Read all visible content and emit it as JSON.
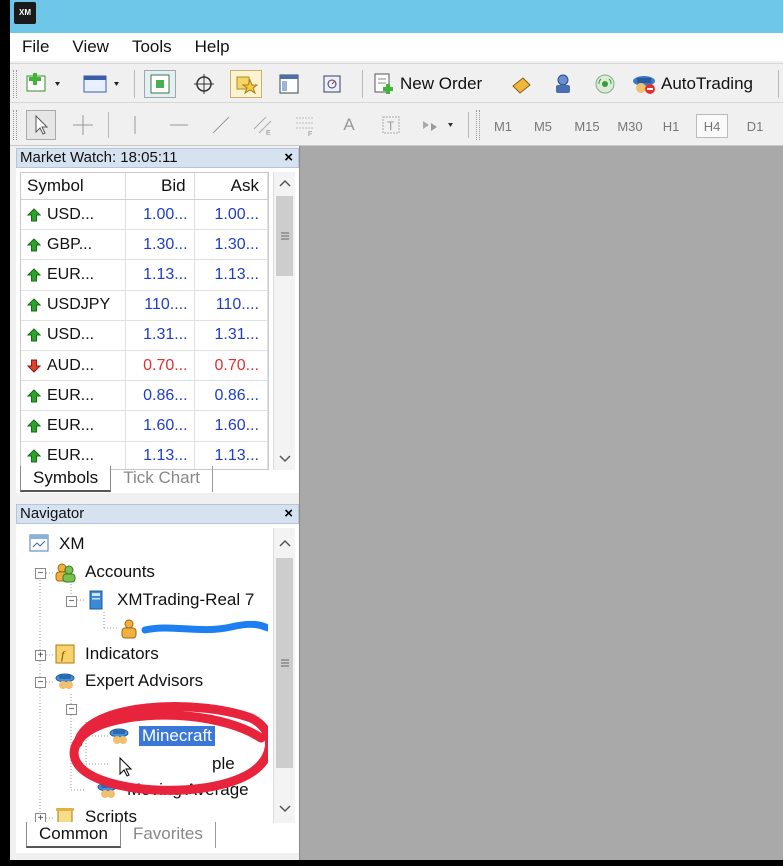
{
  "app": {
    "logo_text": "XM"
  },
  "menu": [
    "File",
    "View",
    "Tools",
    "Help"
  ],
  "toolbar": {
    "new_order": "New Order",
    "autotrading": "AutoTrading",
    "text_tool": "A"
  },
  "timeframes": [
    "M1",
    "M5",
    "M15",
    "M30",
    "H1",
    "H4",
    "D1"
  ],
  "active_timeframe": "H4",
  "market_watch": {
    "title": "Market Watch: 18:05:11",
    "close": "×",
    "columns": [
      "Symbol",
      "Bid",
      "Ask"
    ],
    "rows": [
      {
        "symbol": "USD...",
        "bid": "1.00...",
        "ask": "1.00...",
        "dir": "up"
      },
      {
        "symbol": "GBP...",
        "bid": "1.30...",
        "ask": "1.30...",
        "dir": "up"
      },
      {
        "symbol": "EUR...",
        "bid": "1.13...",
        "ask": "1.13...",
        "dir": "up"
      },
      {
        "symbol": "USDJPY",
        "bid": "110....",
        "ask": "110....",
        "dir": "up"
      },
      {
        "symbol": "USD...",
        "bid": "1.31...",
        "ask": "1.31...",
        "dir": "up"
      },
      {
        "symbol": "AUD...",
        "bid": "0.70...",
        "ask": "0.70...",
        "dir": "down"
      },
      {
        "symbol": "EUR...",
        "bid": "0.86...",
        "ask": "0.86...",
        "dir": "up"
      },
      {
        "symbol": "EUR...",
        "bid": "1.60...",
        "ask": "1.60...",
        "dir": "up"
      },
      {
        "symbol": "EUR...",
        "bid": "1.13...",
        "ask": "1.13...",
        "dir": "up"
      }
    ],
    "tabs": [
      "Symbols",
      "Tick Chart"
    ]
  },
  "navigator": {
    "title": "Navigator",
    "close": "×",
    "root": "XM",
    "accounts": "Accounts",
    "account_name": "XMTrading-Real 7",
    "indicators": "Indicators",
    "expert_advisors": "Expert Advisors",
    "ea_selected": "Minecraft",
    "ea_hidden_suffix": "ple",
    "moving_average": "Moving Average",
    "scripts": "Scripts",
    "tabs": [
      "Common",
      "Favorites"
    ]
  },
  "colors": {
    "titlebar": "#6ec6e8",
    "price_up": "#1f3ec8",
    "price_down": "#e03030",
    "selection": "#3a78d8",
    "annotation_red": "#e8243c",
    "chart_bg": "#a9a9a9"
  }
}
